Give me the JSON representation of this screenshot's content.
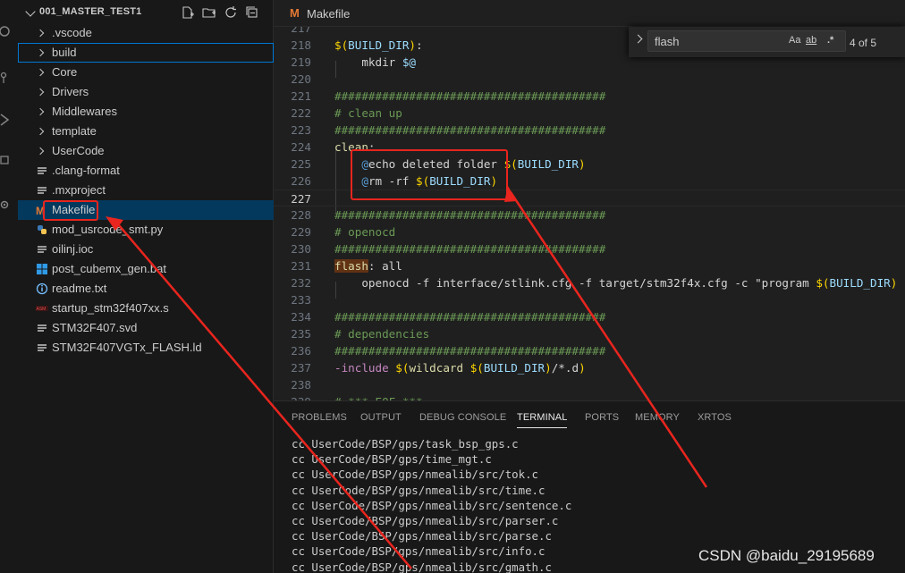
{
  "sidebar": {
    "title": "001_MASTER_TEST1",
    "items": [
      {
        "label": ".vscode",
        "kind": "folder"
      },
      {
        "label": "build",
        "kind": "folder"
      },
      {
        "label": "Core",
        "kind": "folder"
      },
      {
        "label": "Drivers",
        "kind": "folder"
      },
      {
        "label": "Middlewares",
        "kind": "folder"
      },
      {
        "label": "template",
        "kind": "folder"
      },
      {
        "label": "UserCode",
        "kind": "folder"
      },
      {
        "label": ".clang-format",
        "kind": "lines-icon"
      },
      {
        "label": ".mxproject",
        "kind": "lines-icon"
      },
      {
        "label": "Makefile",
        "kind": "makefile-icon"
      },
      {
        "label": "mod_usrcode_smt.py",
        "kind": "python-icon"
      },
      {
        "label": "oilinj.ioc",
        "kind": "lines-icon"
      },
      {
        "label": "post_cubemx_gen.bat",
        "kind": "windows-icon"
      },
      {
        "label": "readme.txt",
        "kind": "info-icon"
      },
      {
        "label": "startup_stm32f407xx.s",
        "kind": "asm-icon"
      },
      {
        "label": "STM32F407.svd",
        "kind": "lines-icon"
      },
      {
        "label": "STM32F407VGTx_FLASH.ld",
        "kind": "lines-icon"
      }
    ]
  },
  "editor": {
    "tab_icon": "M",
    "tab_label": "Makefile",
    "lines": [
      {
        "n": "217",
        "t": "",
        "tokens": []
      },
      {
        "n": "218",
        "tokens": [
          [
            "tok-paren",
            "$("
          ],
          [
            "tok-var",
            "BUILD_DIR"
          ],
          [
            "tok-paren",
            ")"
          ],
          [
            "tok-text",
            ":"
          ]
        ]
      },
      {
        "n": "219",
        "tokens": [
          [
            "tok-text",
            "    mkdir "
          ],
          [
            "tok-var",
            "$@"
          ]
        ]
      },
      {
        "n": "220",
        "tokens": []
      },
      {
        "n": "221",
        "tokens": [
          [
            "tok-comment",
            "########################################"
          ]
        ]
      },
      {
        "n": "222",
        "tokens": [
          [
            "tok-comment",
            "# clean up"
          ]
        ]
      },
      {
        "n": "223",
        "tokens": [
          [
            "tok-comment",
            "########################################"
          ]
        ]
      },
      {
        "n": "224",
        "tokens": [
          [
            "tok-target",
            "clean"
          ],
          [
            "tok-text",
            ":"
          ]
        ]
      },
      {
        "n": "225",
        "tokens": [
          [
            "tok-text",
            "    "
          ],
          [
            "tok-at",
            "@"
          ],
          [
            "tok-text",
            "echo deleted folder "
          ],
          [
            "tok-paren",
            "$("
          ],
          [
            "tok-var",
            "BUILD_DIR"
          ],
          [
            "tok-paren",
            ")"
          ]
        ]
      },
      {
        "n": "226",
        "tokens": [
          [
            "tok-text",
            "    "
          ],
          [
            "tok-at",
            "@"
          ],
          [
            "tok-text",
            "rm -rf "
          ],
          [
            "tok-paren",
            "$("
          ],
          [
            "tok-var",
            "BUILD_DIR"
          ],
          [
            "tok-paren",
            ")"
          ]
        ]
      },
      {
        "n": "227",
        "tokens": []
      },
      {
        "n": "228",
        "tokens": [
          [
            "tok-comment",
            "########################################"
          ]
        ]
      },
      {
        "n": "229",
        "tokens": [
          [
            "tok-comment",
            "# openocd"
          ]
        ]
      },
      {
        "n": "230",
        "tokens": [
          [
            "tok-comment",
            "########################################"
          ]
        ]
      },
      {
        "n": "231",
        "tokens": [
          [
            "tok-target find-hl",
            "flash"
          ],
          [
            "tok-text",
            ": all"
          ]
        ]
      },
      {
        "n": "232",
        "tokens": [
          [
            "tok-text",
            "    openocd -f interface/stlink.cfg -f target/stm32f4x.cfg -c \"program "
          ],
          [
            "tok-paren",
            "$("
          ],
          [
            "tok-var",
            "BUILD_DIR"
          ],
          [
            "tok-paren",
            ")"
          ]
        ]
      },
      {
        "n": "233",
        "tokens": []
      },
      {
        "n": "234",
        "tokens": [
          [
            "tok-comment",
            "########################################"
          ]
        ]
      },
      {
        "n": "235",
        "tokens": [
          [
            "tok-comment",
            "# dependencies"
          ]
        ]
      },
      {
        "n": "236",
        "tokens": [
          [
            "tok-comment",
            "########################################"
          ]
        ]
      },
      {
        "n": "237",
        "tokens": [
          [
            "tok-kw",
            "-include"
          ],
          [
            "tok-text",
            " "
          ],
          [
            "tok-paren",
            "$("
          ],
          [
            "tok-fn",
            "wildcard"
          ],
          [
            "tok-text",
            " "
          ],
          [
            "tok-paren",
            "$("
          ],
          [
            "tok-var",
            "BUILD_DIR"
          ],
          [
            "tok-paren",
            ")"
          ],
          [
            "tok-text",
            "/*.d"
          ],
          [
            "tok-paren",
            ")"
          ]
        ]
      },
      {
        "n": "238",
        "tokens": []
      },
      {
        "n": "239",
        "tokens": [
          [
            "tok-comment",
            "# *** EOF ***"
          ]
        ]
      }
    ]
  },
  "find": {
    "value": "flash",
    "match_case": "Aa",
    "whole_word": "ab",
    "regex": ".*",
    "count": "4 of 5"
  },
  "panel": {
    "tabs": [
      "PROBLEMS",
      "OUTPUT",
      "DEBUG CONSOLE",
      "TERMINAL",
      "PORTS",
      "MEMORY",
      "XRTOS"
    ],
    "active_tab": "TERMINAL",
    "terminal_lines": [
      "cc UserCode/BSP/gps/task_bsp_gps.c",
      "cc UserCode/BSP/gps/time_mgt.c",
      "cc UserCode/BSP/gps/nmealib/src/tok.c",
      "cc UserCode/BSP/gps/nmealib/src/time.c",
      "cc UserCode/BSP/gps/nmealib/src/sentence.c",
      "cc UserCode/BSP/gps/nmealib/src/parser.c",
      "cc UserCode/BSP/gps/nmealib/src/parse.c",
      "cc UserCode/BSP/gps/nmealib/src/info.c",
      "cc UserCode/BSP/gps/nmealib/src/gmath.c"
    ]
  },
  "watermark": "CSDN @baidu_29195689",
  "colors": {
    "annotation": "#e8251e",
    "accent": "#0078d4",
    "makefile_icon": "#e37933"
  }
}
